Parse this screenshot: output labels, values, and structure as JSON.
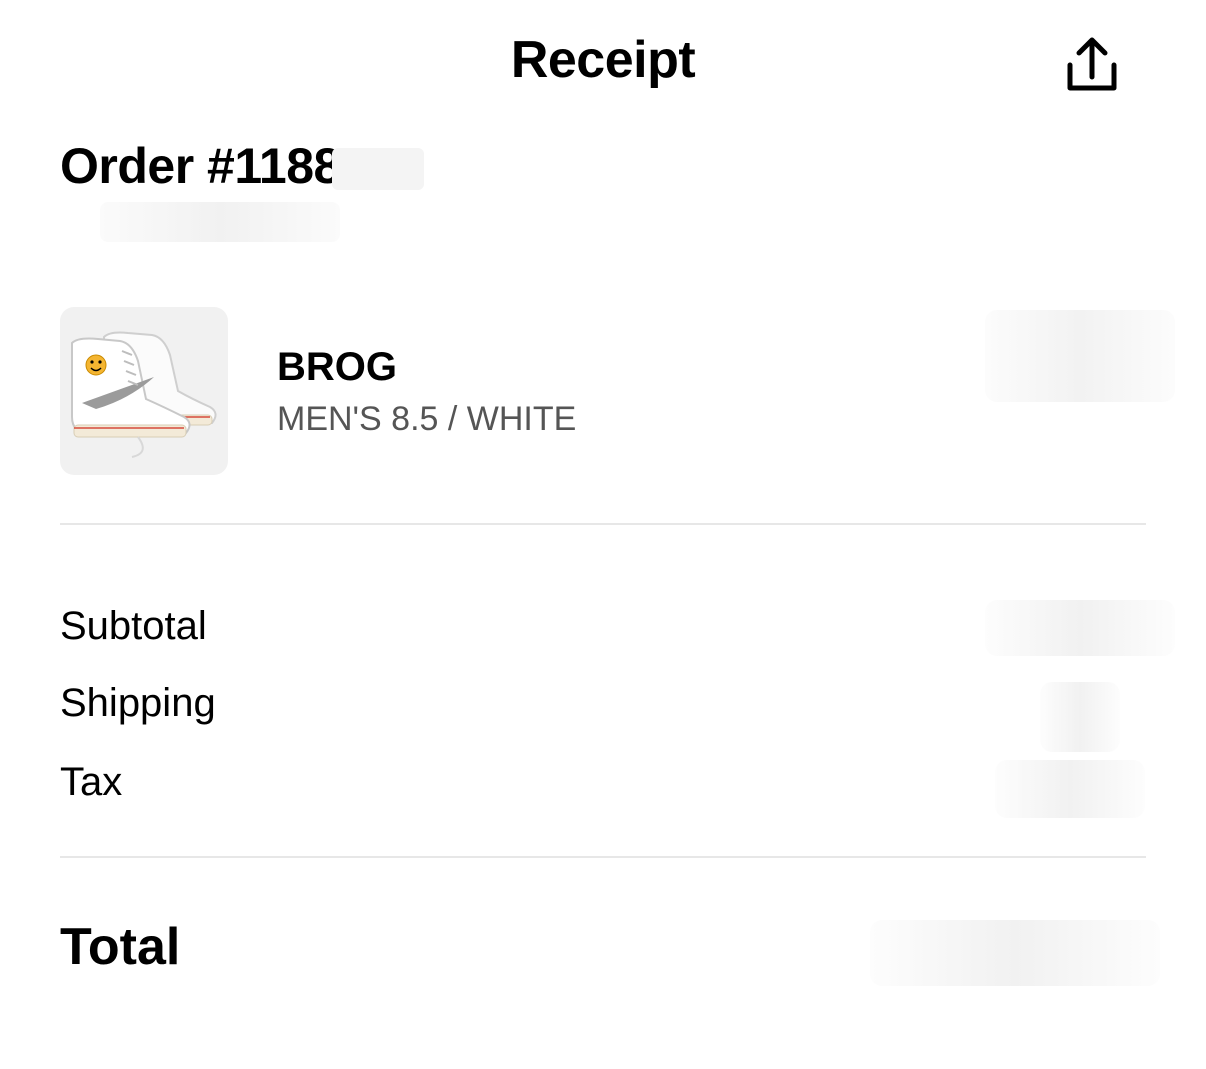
{
  "header": {
    "title": "Receipt",
    "share_icon": "share-upload-icon"
  },
  "order": {
    "title": "Order #1188"
  },
  "item": {
    "name": "BROG",
    "variant": "MEN'S 8.5 / WHITE",
    "image_icon": "sneaker-product-image"
  },
  "summary": {
    "subtotal_label": "Subtotal",
    "shipping_label": "Shipping",
    "tax_label": "Tax",
    "total_label": "Total"
  },
  "colors": {
    "background": "#ffffff",
    "text": "#000000",
    "secondary_text": "#555555",
    "divider": "#e7e7e7",
    "thumb_bg": "#f1f1f1"
  }
}
